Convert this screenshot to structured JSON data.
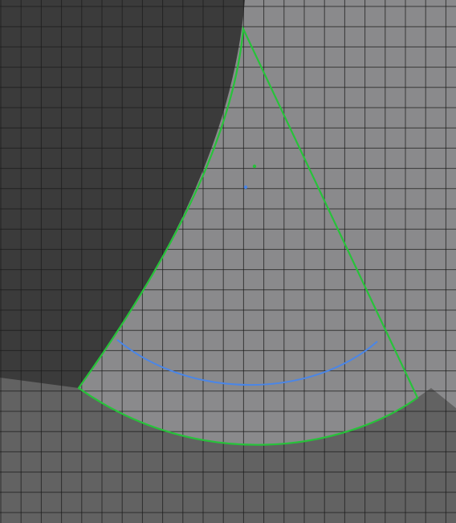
{
  "scene": {
    "colors": {
      "dark_region": "#3b3b3b",
      "light_region": "#8a8a8c",
      "bottom_region": "#626262",
      "grid_line": "#1c1c1c",
      "sector_outline": "#27c23a",
      "inner_arc": "#4a86e8",
      "pivot_point": "#27c23a",
      "center_point": "#4a86e8"
    },
    "icons": {
      "pivot_point": "green-dot",
      "center_point": "blue-dot"
    }
  }
}
